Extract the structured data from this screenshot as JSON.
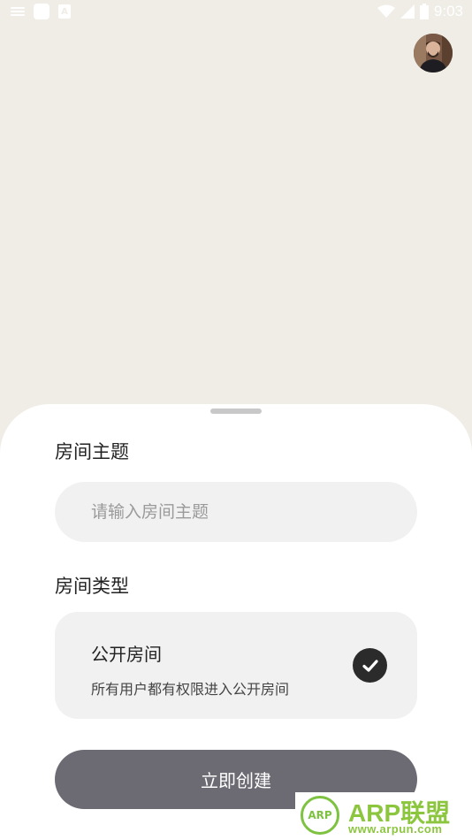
{
  "status_bar": {
    "time": "9:03",
    "icons": [
      "notification-lines-icon",
      "app-square-icon",
      "app-a-icon",
      "wifi-icon",
      "signal-icon",
      "battery-icon"
    ]
  },
  "avatar": {
    "icon": "user-avatar"
  },
  "sheet": {
    "subject_label": "房间主题",
    "subject_placeholder": "请输入房间主题",
    "subject_value": "",
    "type_label": "房间类型",
    "option": {
      "title": "公开房间",
      "description": "所有用户都有权限进入公开房间",
      "selected": true
    },
    "create_button": "立即创建"
  },
  "watermark": {
    "badge": "ARP",
    "title": "ARP联盟",
    "url": "www.arpun.com"
  },
  "colors": {
    "background": "#efede6",
    "sheet": "#ffffff",
    "field": "#f1f1f1",
    "button": "#6c6b73",
    "check": "#2b2b2b",
    "watermark": "#8cc63f"
  }
}
